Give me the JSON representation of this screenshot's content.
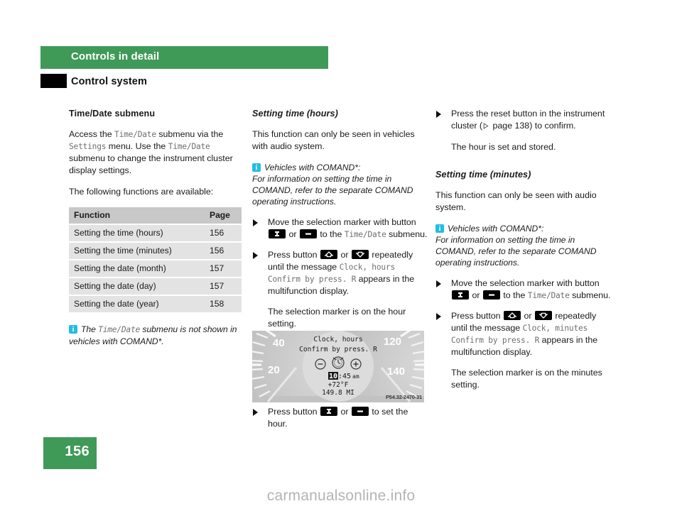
{
  "header": {
    "chapter_title": "Controls in detail",
    "section_title": "Control system"
  },
  "left_column": {
    "heading": "Time/Date submenu",
    "paragraph1": {
      "part1": "Access the ",
      "mono1": "Time/Date",
      "part2": " submenu via the ",
      "mono2": "Settings",
      "part3": " menu. Use the ",
      "mono3": "Time/Date",
      "part4": " submenu to change the instrument cluster display settings."
    },
    "paragraph2": "The following functions are available:",
    "table": {
      "headers": [
        "Function",
        "Page"
      ],
      "rows": [
        [
          "Setting the time (hours)",
          "156"
        ],
        [
          "Setting the time (minutes)",
          "156"
        ],
        [
          "Setting the date (month)",
          "157"
        ],
        [
          "Setting the date (day)",
          "157"
        ],
        [
          "Setting the date (year)",
          "158"
        ]
      ]
    },
    "note": {
      "icon": "info-icon",
      "part1": "The ",
      "mono1": "Time/Date",
      "part2": " submenu is not shown in vehicles with COMAND*."
    }
  },
  "middle_column": {
    "heading": "Setting time (hours)",
    "paragraph1": "This function can only be seen in vehicles with audio system.",
    "note": {
      "icon": "info-icon",
      "title": "Vehicles with COMAND*:",
      "body": "For information on setting the time in COMAND, refer to the separate COMAND operating instructions."
    },
    "step1": {
      "part1": "Move the selection marker with button ",
      "key1": "plus-key",
      "part2": " or ",
      "key2": "minus-key",
      "part3": " to the ",
      "mono1": "Time/Date",
      "part4": " submenu."
    },
    "step2": {
      "part1": "Press button ",
      "key1": "up-arrow-key",
      "part2": " or ",
      "key2": "down-arrow-key",
      "part3": " repeatedly until the message ",
      "mono1": "Clock, hours Confirm by press. R",
      "part4": " appears in the multifunction display."
    },
    "step2_sub": "The selection marker is on the hour setting.",
    "figure": {
      "id_label": "P54.32-2470-31",
      "display_line1": "Clock, hours",
      "display_line2": "Confirm by press. R",
      "display_time_highlight": "10",
      "display_time_rest": ":45",
      "display_ampm": "am",
      "display_temp": "+72°F",
      "display_odometer": "149.8 MI",
      "gauge_labels": [
        "40",
        "20",
        "120",
        "140"
      ],
      "icon_minus": "minus-circle-icon",
      "icon_clock": "clock-icon",
      "icon_plus": "plus-circle-icon"
    },
    "step3": {
      "part1": "Press button ",
      "key1": "plus-key",
      "part2": " or ",
      "key2": "minus-key",
      "part3": " to set the hour."
    }
  },
  "right_column": {
    "step1": {
      "part1": "Press the reset button in the instrument cluster (",
      "ref_icon": "page-ref-triangle-icon",
      "ref_text": " page 138",
      "part2": ") to confirm."
    },
    "step1_sub": "The hour is set and stored.",
    "heading": "Setting time (minutes)",
    "paragraph1": "This function can only be seen with audio system.",
    "note": {
      "icon": "info-icon",
      "title": "Vehicles with COMAND*:",
      "body": "For information on setting the time in COMAND, refer to the separate COMAND operating instructions."
    },
    "step2": {
      "part1": "Move the selection marker with button ",
      "key1": "plus-key",
      "part2": " or ",
      "key2": "minus-key",
      "part3": " to the ",
      "mono1": "Time/Date",
      "part4": " submenu."
    },
    "step3": {
      "part1": "Press button ",
      "key1": "up-arrow-key",
      "part2": " or ",
      "key2": "down-arrow-key",
      "part3": " repeatedly until the message ",
      "mono1": "Clock, minutes Confirm by press. R",
      "part4": " appears in the multifunction display."
    },
    "step3_sub": "The selection marker is on the minutes setting."
  },
  "footer": {
    "page_number": "156",
    "watermark": "carmanualsonline.info"
  },
  "colors": {
    "brand_green": "#3f9a58",
    "info_cyan": "#21bde5",
    "table_header": "#c8c8c8",
    "table_row": "#e3e3e3",
    "watermark_gray": "#b4b4b4"
  }
}
